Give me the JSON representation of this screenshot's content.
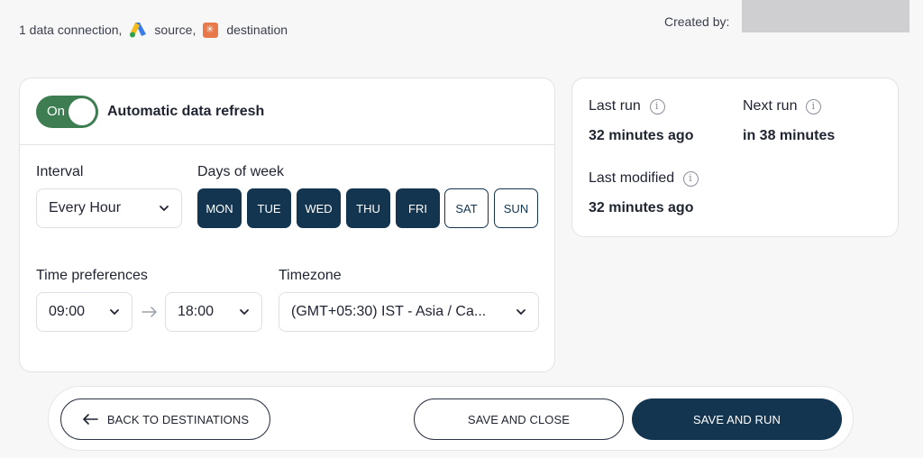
{
  "header": {
    "connections_text": "1 data connection,",
    "source_text": "source,",
    "destination_text": "destination",
    "created_by_label": "Created by: ",
    "source_icon": "google-ads-icon",
    "destination_icon": "destination-app-icon"
  },
  "refresh": {
    "toggle_label": "On",
    "toggle_state": true,
    "title": "Automatic data refresh",
    "interval_label": "Interval",
    "interval_value": "Every Hour",
    "days_label": "Days of week",
    "days": [
      {
        "label": "MON",
        "selected": true
      },
      {
        "label": "TUE",
        "selected": true
      },
      {
        "label": "WED",
        "selected": true
      },
      {
        "label": "THU",
        "selected": true
      },
      {
        "label": "FRI",
        "selected": true
      },
      {
        "label": "SAT",
        "selected": false
      },
      {
        "label": "SUN",
        "selected": false
      }
    ],
    "time_pref_label": "Time preferences",
    "time_start": "09:00",
    "time_end": "18:00",
    "timezone_label": "Timezone",
    "timezone_value": "(GMT+05:30) IST - Asia / Ca..."
  },
  "run_info": {
    "last_run_label": "Last run",
    "last_run_value": "32 minutes ago",
    "next_run_label": "Next run",
    "next_run_value": "in 38 minutes",
    "last_modified_label": "Last modified",
    "last_modified_value": "32 minutes ago"
  },
  "footer": {
    "back_label": "BACK TO DESTINATIONS",
    "save_close_label": "SAVE AND CLOSE",
    "save_run_label": "SAVE AND RUN"
  },
  "colors": {
    "accent_navy": "#133550",
    "toggle_green": "#3e7d52",
    "redaction_gray": "#cfcfd1"
  }
}
